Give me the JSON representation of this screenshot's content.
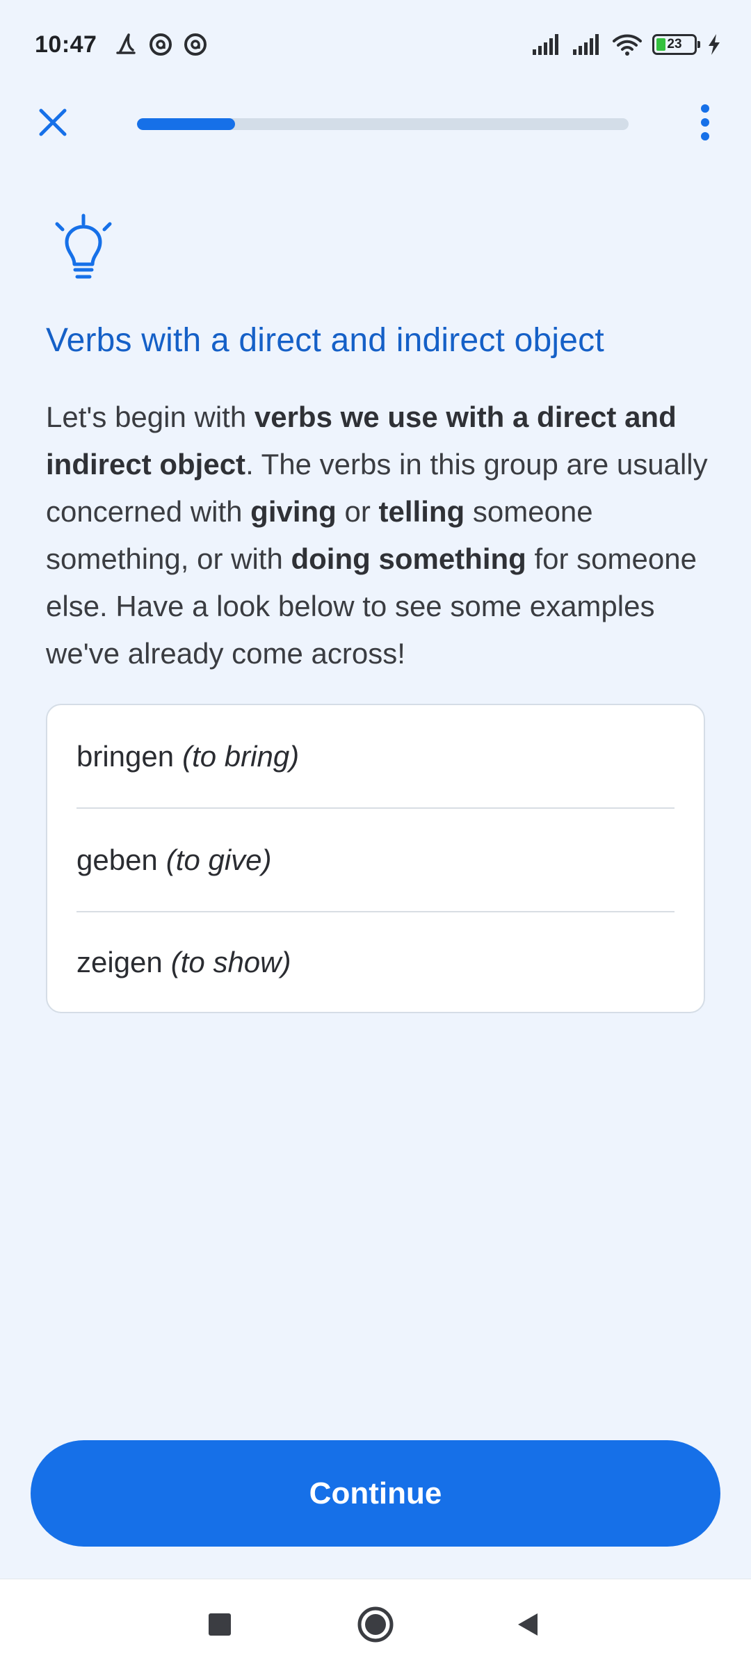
{
  "status_bar": {
    "time": "10:47",
    "battery_level": "23",
    "battery_fill_fraction": 0.23,
    "left_icons": [
      "fishing-icon",
      "at-sign-icon",
      "at-sign-icon"
    ],
    "right_icons": [
      "signal-icon",
      "signal-icon",
      "wifi-icon",
      "battery-icon",
      "charging-icon"
    ]
  },
  "top_nav": {
    "close_icon": "close-icon",
    "progress_fraction": 0.2,
    "menu_icon": "more-vertical-icon"
  },
  "lesson": {
    "tip_icon": "lightbulb-icon",
    "title": "Verbs with a direct and indirect object",
    "body": {
      "p1": "Let's begin with ",
      "b1": "verbs we use with a direct and indirect object",
      "p2": ". The verbs in this group are usually concerned with ",
      "b2": "giving",
      "p3": " or ",
      "b3": "telling",
      "p4": " someone something, or with ",
      "b4": "doing something",
      "p5": " for someone else. Have a look below to see some examples we've already come across!"
    },
    "examples": [
      {
        "word": "bringen",
        "translation": "(to bring)"
      },
      {
        "word": "geben",
        "translation": "(to give)"
      },
      {
        "word": "zeigen",
        "translation": "(to show)"
      }
    ]
  },
  "continue_label": "Continue",
  "colors": {
    "accent": "#1670e8",
    "title": "#1560c7",
    "background": "#eef4fd"
  },
  "system_nav": {
    "icons": [
      "recents-icon",
      "home-icon",
      "back-icon"
    ]
  }
}
